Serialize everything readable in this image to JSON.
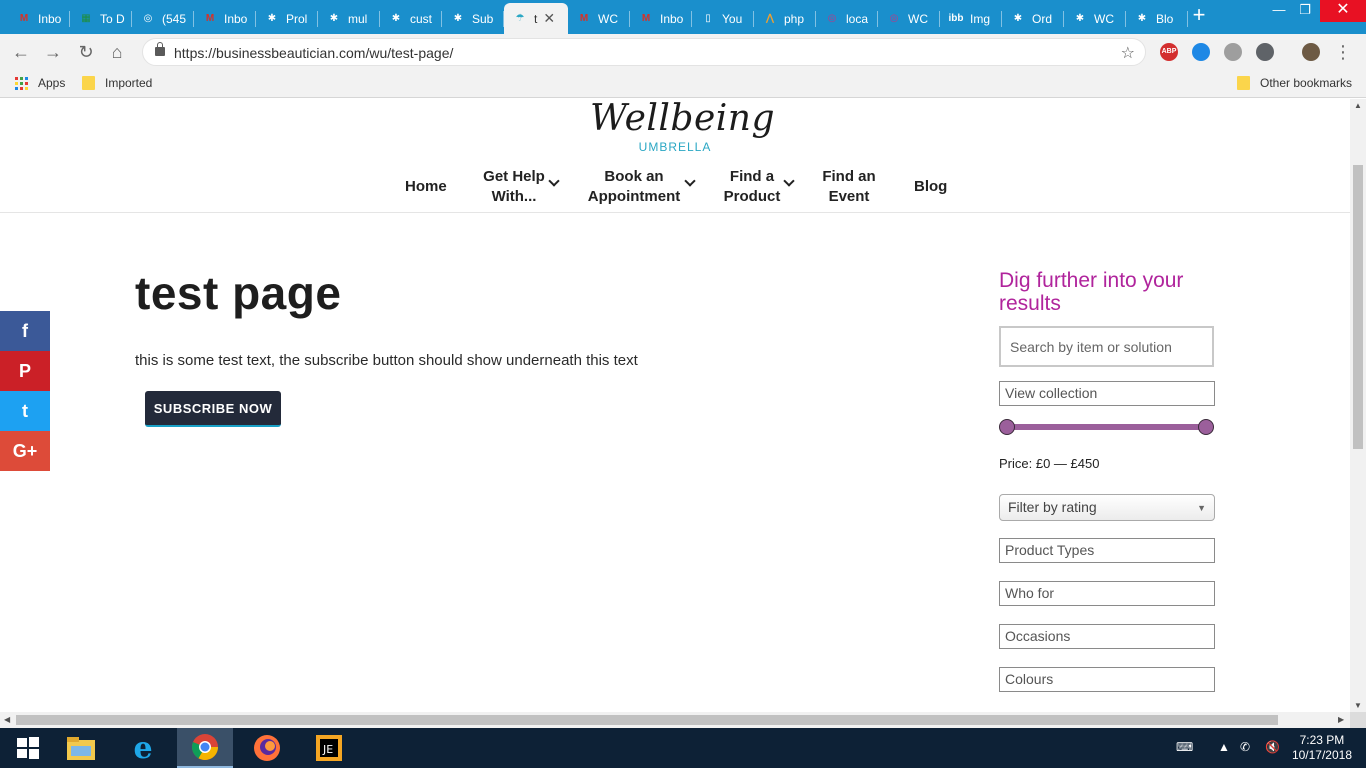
{
  "browser": {
    "tabs": [
      {
        "label": "Inbo",
        "icon": "gmail-icon",
        "color": "#d93025",
        "glyph": "M"
      },
      {
        "label": "To D",
        "icon": "sheets-icon",
        "color": "#1e8e3e",
        "glyph": "▦"
      },
      {
        "label": "(545",
        "icon": "mail-icon",
        "color": "#ffffff",
        "glyph": "◎"
      },
      {
        "label": "Inbo",
        "icon": "gmail-icon",
        "color": "#d93025",
        "glyph": "M"
      },
      {
        "label": "Prol",
        "icon": "wordpress-icon",
        "color": "#ffffff",
        "glyph": "✱"
      },
      {
        "label": "mul",
        "icon": "wordpress-icon",
        "color": "#ffffff",
        "glyph": "✱"
      },
      {
        "label": "cust",
        "icon": "wordpress-icon",
        "color": "#ffffff",
        "glyph": "✱"
      },
      {
        "label": "Sub",
        "icon": "wordpress-icon",
        "color": "#ffffff",
        "glyph": "✱"
      },
      {
        "label": "t",
        "icon": "umbrella-icon",
        "color": "#2ba7c4",
        "glyph": "☂",
        "active": true
      },
      {
        "label": "WC",
        "icon": "gmail-icon",
        "color": "#d93025",
        "glyph": "M"
      },
      {
        "label": "Inbo",
        "icon": "gmail-icon",
        "color": "#d93025",
        "glyph": "M"
      },
      {
        "label": "You",
        "icon": "document-icon",
        "color": "#ffffff",
        "glyph": "▯"
      },
      {
        "label": "php",
        "icon": "php-icon",
        "color": "#f0a030",
        "glyph": "⋀"
      },
      {
        "label": "loca",
        "icon": "instagram-icon",
        "color": "#c13584",
        "glyph": "◎"
      },
      {
        "label": "WC",
        "icon": "instagram-icon",
        "color": "#c13584",
        "glyph": "◎"
      },
      {
        "label": "Img",
        "icon": "imgbb-icon",
        "color": "#ffffff",
        "glyph": "ibb"
      },
      {
        "label": "Ord",
        "icon": "wordpress-icon",
        "color": "#ffffff",
        "glyph": "✱"
      },
      {
        "label": "WC",
        "icon": "wordpress-icon",
        "color": "#ffffff",
        "glyph": "✱"
      },
      {
        "label": "Blo",
        "icon": "wordpress-icon",
        "color": "#ffffff",
        "glyph": "✱"
      }
    ],
    "url": "https://businessbeautician.com/wu/test-page/",
    "bookmarks": [
      {
        "label": "Apps",
        "icon": "apps-icon"
      },
      {
        "label": "Imported",
        "icon": "folder-icon"
      }
    ],
    "other_bookmarks": "Other bookmarks",
    "extensions": [
      {
        "name": "adblock-plus-icon",
        "label": "ABP",
        "color": "#d32f2f"
      },
      {
        "name": "camera-extension-icon",
        "label": "",
        "color": "#1e88e5"
      },
      {
        "name": "grey-circle-icon",
        "label": "",
        "color": "#9e9e9e"
      },
      {
        "name": "shield-extension-icon",
        "label": "",
        "color": "#5f6368"
      }
    ]
  },
  "site": {
    "logo_script": "Wellbeing",
    "logo_sub": "UMBRELLA",
    "nav": [
      {
        "label": "Home",
        "dropdown": false
      },
      {
        "label": "Get Help With...",
        "dropdown": true
      },
      {
        "label": "Book an Appointment",
        "dropdown": true
      },
      {
        "label": "Find a Product",
        "dropdown": true
      },
      {
        "label": "Find an Event",
        "dropdown": false
      },
      {
        "label": "Blog",
        "dropdown": false
      }
    ],
    "share": [
      {
        "label": "f",
        "icon": "facebook-icon",
        "color": "#3b5998"
      },
      {
        "label": "P",
        "icon": "pinterest-icon",
        "color": "#cb2027"
      },
      {
        "label": "t",
        "icon": "twitter-icon",
        "color": "#1da1f2"
      },
      {
        "label": "G+",
        "icon": "google-plus-icon",
        "color": "#dd4b39"
      }
    ]
  },
  "main": {
    "title": "test page",
    "body": "this is some test text, the subscribe button should show underneath this text",
    "subscribe_label": "SUBSCRIBE NOW"
  },
  "sidebar": {
    "title": "Dig further into your results",
    "search_placeholder": "Search by item or solution",
    "view_collection": "View collection",
    "price_label": "Price: £0 — £450",
    "price_min": 0,
    "price_max": 450,
    "rating_label": "Filter by rating",
    "filters": [
      "Product Types",
      "Who for",
      "Occasions",
      "Colours"
    ]
  },
  "taskbar": {
    "apps": [
      {
        "name": "file-explorer-icon"
      },
      {
        "name": "internet-explorer-icon"
      },
      {
        "name": "chrome-icon",
        "active": true
      },
      {
        "name": "firefox-icon"
      },
      {
        "name": "jetbrains-icon"
      }
    ],
    "time": "7:23 PM",
    "date": "10/17/2018"
  },
  "colors": {
    "tab_strip": "#1a8fcc",
    "accent_purple": "#b0249c",
    "slider": "#9b5f9b",
    "button": "#232a3a",
    "logo_sub": "#2ba7c4"
  }
}
